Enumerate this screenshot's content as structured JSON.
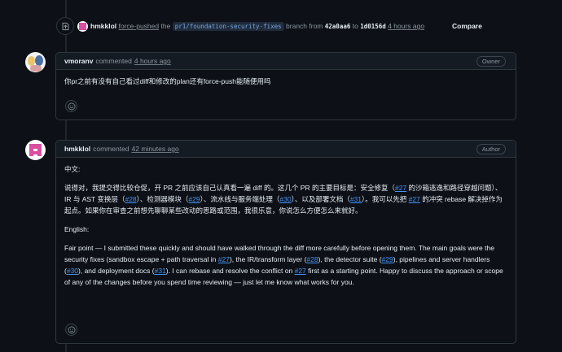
{
  "event": {
    "user": "hmkklol",
    "action": "force-pushed",
    "the": "the",
    "branch_ref": "pr1/foundation-security-fixes",
    "branch_from": "branch from",
    "sha_from": "42a0aa6",
    "to": "to",
    "sha_to": "1d0156d",
    "time": "4 hours ago",
    "compare_label": "Compare"
  },
  "comment1": {
    "author": "vmoranv",
    "verb": "commented",
    "time": "4 hours ago",
    "badge": "Owner",
    "body": "你pr之前有没有自己看过diff和修改的plan还有force-push能随便用吗"
  },
  "comment2": {
    "author": "hmkklol",
    "verb": "commented",
    "time": "42 minutes ago",
    "badge": "Author",
    "zh_heading": "中文:",
    "zh_p1": "说得对，我提交得比较仓促，开 PR 之前应该自己认真看一遍 diff 的。这几个 PR 的主要目标是：安全修复（",
    "link_27": "#27",
    "zh_p2": " 的沙箱逃逸和路径穿越问题）、IR 与 AST 变换层（",
    "link_28": "#28",
    "zh_p3": "）、检测器模块（",
    "link_29": "#29",
    "zh_p4": "）、流水线与服务端处理（",
    "link_30": "#30",
    "zh_p5": "）、以及部署文档（",
    "link_31": "#31",
    "zh_p6": "）。我可以先把 ",
    "zh_p7": " 的冲突 rebase 解决掉作为起点。如果你在审查之前想先聊聊某些改动的思路或范围，我很乐意，你说怎么方便怎么来就好。",
    "en_heading": "English:",
    "en_p1": "Fair point — I submitted these quickly and should have walked through the diff more carefully before opening them. The main goals were the security fixes (sandbox escape + path traversal in ",
    "en_p2": "), the IR/transform layer (",
    "en_p3": "), the detector suite (",
    "en_p4": "), pipelines and server handlers (",
    "en_p5": "), and deployment docs (",
    "en_p6": "). I can rebase and resolve the conflict on ",
    "en_p7": " first as a starting point. Happy to discuss the approach or scope of any of the changes before you spend time reviewing — just let me know what works for you."
  },
  "icons": {
    "push": "repo-push-icon",
    "reaction": "smiley-icon"
  },
  "colors": {
    "background": "#0d1117",
    "link": "#4493f8",
    "border": "#30363d"
  }
}
